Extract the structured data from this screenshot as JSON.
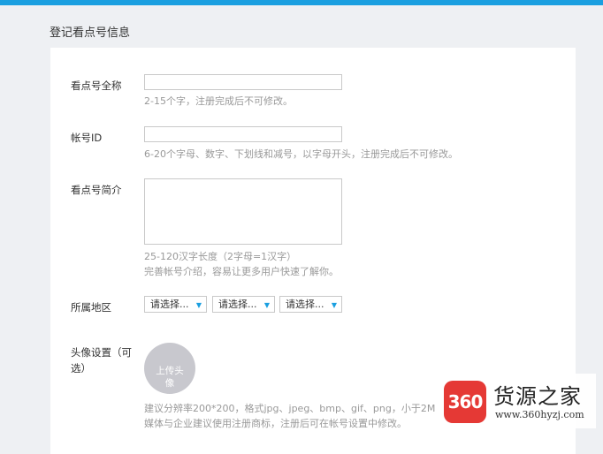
{
  "page": {
    "section_title": "登记看点号信息",
    "accent_color": "#1a9fe0"
  },
  "form": {
    "full_name": {
      "label": "看点号全称",
      "value": "",
      "hint": "2-15个字，注册完成后不可修改。"
    },
    "account_id": {
      "label": "帐号ID",
      "value": "",
      "hint": "6-20个字母、数字、下划线和减号，以字母开头，注册完成后不可修改。"
    },
    "intro": {
      "label": "看点号简介",
      "value": "",
      "hint_line1": "25-120汉字长度（2字母=1汉字）",
      "hint_line2": "完善帐号介绍，容易让更多用户快速了解你。"
    },
    "region": {
      "label": "所属地区",
      "selects": [
        {
          "value": "请选择..."
        },
        {
          "value": "请选择..."
        },
        {
          "value": "请选择..."
        }
      ],
      "chevron_icon": "chevron-down-icon"
    },
    "avatar": {
      "label": "头像设置（可选）",
      "upload_text": "上传头像",
      "hint_line1": "建议分辨率200*200，格式jpg、jpeg、bmp、gif、png，小于2M",
      "hint_line2": "媒体与企业建议使用注册商标，注册后可在帐号设置中修改。"
    }
  },
  "watermark": {
    "logo_text": "360",
    "name": "货源之家",
    "url": "www.360hyzj.com",
    "logo_color": "#e53935"
  }
}
